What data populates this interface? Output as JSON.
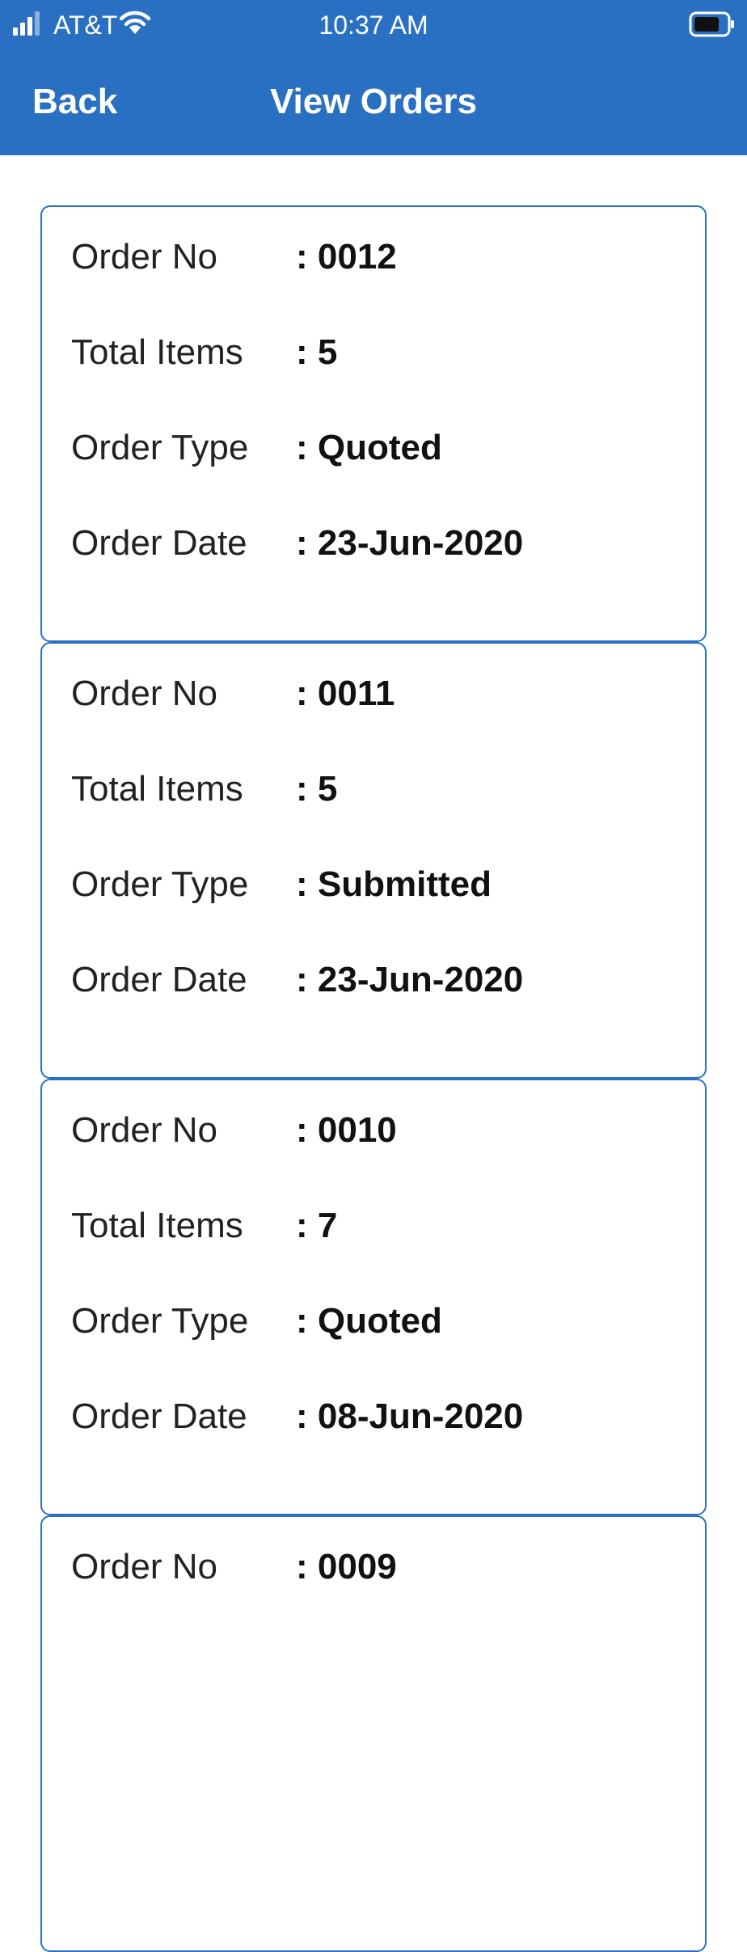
{
  "status_bar": {
    "carrier": "AT&T",
    "time": "10:37 AM"
  },
  "nav": {
    "back_label": "Back",
    "title": "View Orders"
  },
  "orders": [
    {
      "order_no": {
        "label": "Order No",
        "value": ": 0012"
      },
      "total_items": {
        "label": "Total Items",
        "value": ": 5"
      },
      "order_type": {
        "label": "Order Type",
        "value": ": Quoted"
      },
      "order_date": {
        "label": "Order Date",
        "value": ": 23-Jun-2020"
      }
    },
    {
      "order_no": {
        "label": "Order No",
        "value": ": 0011"
      },
      "total_items": {
        "label": "Total Items",
        "value": ": 5"
      },
      "order_type": {
        "label": "Order Type",
        "value": ": Submitted"
      },
      "order_date": {
        "label": "Order Date",
        "value": ": 23-Jun-2020"
      }
    },
    {
      "order_no": {
        "label": "Order No",
        "value": ": 0010"
      },
      "total_items": {
        "label": "Total Items",
        "value": ": 7"
      },
      "order_type": {
        "label": "Order Type",
        "value": ": Quoted"
      },
      "order_date": {
        "label": "Order Date",
        "value": ": 08-Jun-2020"
      }
    },
    {
      "order_no": {
        "label": "Order No",
        "value": ": 0009"
      }
    }
  ],
  "colors": {
    "header_bg": "#2a70c2",
    "card_border": "#2a70c2"
  },
  "icons": [
    "signal-icon",
    "wifi-icon",
    "battery-icon"
  ]
}
